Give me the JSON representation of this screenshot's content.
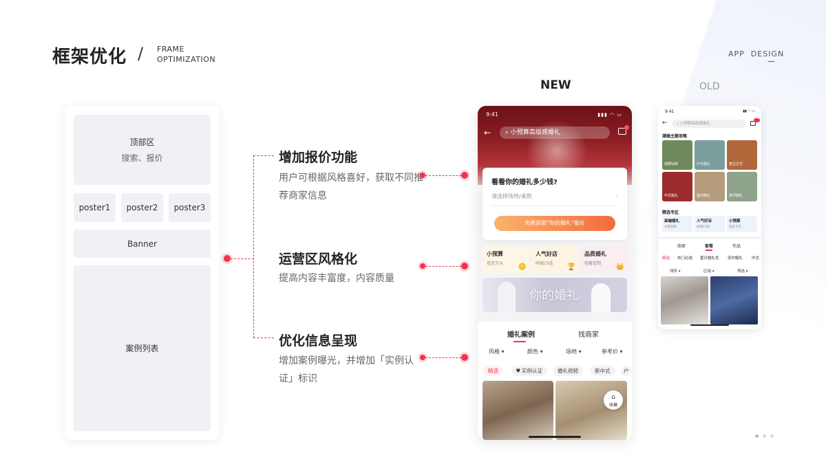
{
  "header": {
    "title": "框架优化",
    "slash": "/",
    "subtitle_line1": "FRAME",
    "subtitle_line2": "OPTIMIZATION",
    "brand": "APP  DESIGN"
  },
  "wireframe": {
    "top_area": {
      "title": "顶部区",
      "sub": "搜索、报价"
    },
    "posters": [
      "poster1",
      "poster2",
      "poster3"
    ],
    "banner": "Banner",
    "case_list": "案例列表"
  },
  "features": [
    {
      "title": "增加报价功能",
      "desc": "用户可根据风格喜好，获取不同推荐商家信息"
    },
    {
      "title": "运营区风格化",
      "desc": "提高内容丰富度，内容质量"
    },
    {
      "title": "优化信息呈现",
      "desc": "增加案例曝光，并增加「实例认证」标识"
    }
  ],
  "labels": {
    "new": "NEW",
    "old": "OLD"
  },
  "new_phone": {
    "time": "9:41",
    "search_placeholder": "小预算高级感婚礼",
    "quote_title": "看看你的婚礼多少钱?",
    "quote_input": "请选择场地/桌数",
    "quote_button": "免费获取\"你的婚礼\"报价",
    "ops": [
      {
        "title": "小预算",
        "sub": "低至万元",
        "icon": "coin-icon",
        "bg": "#fdf6e6"
      },
      {
        "title": "人气好店",
        "sub": "同城15佳",
        "icon": "trophy-icon",
        "bg": "#fdf4e3"
      },
      {
        "title": "品质婚礼",
        "sub": "轻奢定制",
        "icon": "crown-icon",
        "bg": "#fbeef1"
      }
    ],
    "banner_text": "你的婚礼",
    "tabs": [
      "婚礼案例",
      "找商家"
    ],
    "filters": [
      "风格",
      "颜色",
      "场地",
      "参考价"
    ],
    "chips": [
      "精选",
      "实例认证",
      "婚礼视频",
      "新中式",
      "户"
    ],
    "fav_label": "收藏"
  },
  "old_phone": {
    "time": "9:41",
    "search_placeholder": "小预算高级感婚礼",
    "section1": "潮婚主题攻略",
    "grid": [
      {
        "label": "绿野仙踪",
        "color": "#6f8a5a"
      },
      {
        "label": "户外婚礼",
        "color": "#7a9e9c"
      },
      {
        "label": "复古文艺",
        "color": "#b0683a"
      },
      {
        "label": "中式婚礼",
        "color": "#9e2b2b"
      },
      {
        "label": "室内婚礼",
        "color": "#b59c7c"
      },
      {
        "label": "草坪婚礼",
        "color": "#8fa38b"
      }
    ],
    "section2": "精选专区",
    "zones": [
      {
        "title": "高端婚礼",
        "sub": "大牌定制"
      },
      {
        "title": "人气好店",
        "sub": "同城15佳"
      },
      {
        "title": "小预算",
        "sub": "低至千元"
      }
    ],
    "tabs": [
      "商家",
      "套餐",
      "作品"
    ],
    "chips": [
      "精选",
      "热门必选",
      "夏日婚礼色",
      "农村婚礼",
      "中式"
    ],
    "filters": [
      "排序",
      "区域",
      "筛选"
    ]
  },
  "colors": {
    "accent": "#f0334e",
    "button_start": "#fbb26c",
    "button_end": "#f36b3d"
  }
}
